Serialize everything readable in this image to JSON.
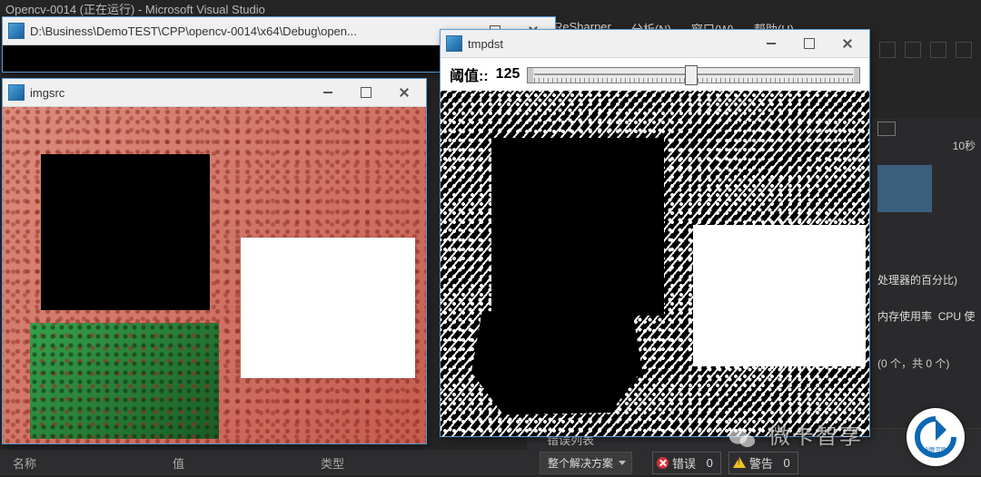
{
  "vs": {
    "title_fragment": "Opencv-0014 (正在运行) - Microsoft Visual Studio",
    "menu": {
      "resharper": "ReSharper",
      "analyze": "分析(N)",
      "window": "窗口(W)",
      "help": "帮助(H)"
    }
  },
  "console_window": {
    "title": "D:\\Business\\DemoTEST\\CPP\\opencv-0014\\x64\\Debug\\open..."
  },
  "imgsrc_window": {
    "title": "imgsrc"
  },
  "tmpdst_window": {
    "title": "tmpdst",
    "trackbar": {
      "label": "阈值::",
      "value": "125",
      "pos_pct": 49
    }
  },
  "diag": {
    "sec": "10秒",
    "cpu_pct_label": "处理器的百分比)",
    "mem": "内存使用率",
    "cpu": "CPU 使",
    "counts": "(0 个，共 0 个)"
  },
  "bottom_left": {
    "name": "名称",
    "value": "值",
    "type": "类型"
  },
  "errors": {
    "header": "错误列表",
    "scope": "整个解决方案",
    "err_label": "错误",
    "err_count": "0",
    "warn_label": "警告",
    "warn_count": "0"
  },
  "watermark": {
    "text": "微卡智享",
    "logo": "创新互联"
  }
}
